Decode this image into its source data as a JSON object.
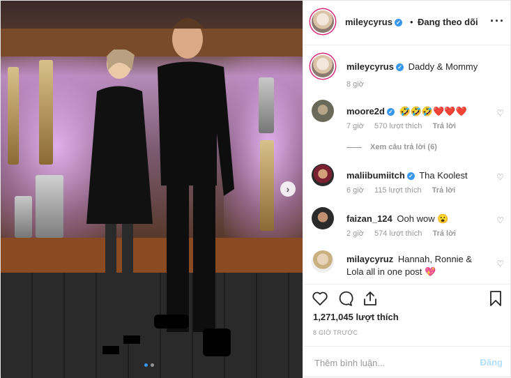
{
  "header": {
    "username": "mileycyrus",
    "separator": "•",
    "follow_label": "Đang theo dõi",
    "more_icon": "more-horizontal-icon"
  },
  "caption": {
    "username": "mileycyrus",
    "text": "Daddy & Mommy",
    "time": "8 giờ"
  },
  "comments": [
    {
      "username": "moore2d",
      "text": "🤣🤣🤣❤️❤️❤️",
      "time": "7 giờ",
      "likes": "570 lượt thích",
      "reply": "Trả lời"
    },
    {
      "username": "maliibumiitch",
      "text": "Tha Koolest",
      "time": "6 giờ",
      "likes": "115 lượt thích",
      "reply": "Trả lời"
    },
    {
      "username": "faizan_124",
      "text": "Ooh wow 😮",
      "time": "2 giờ",
      "likes": "574 lượt thích",
      "reply": "Trả lời"
    },
    {
      "username": "milaycyruz",
      "text": "Hannah, Ronnie & Lola all in one post 💖"
    }
  ],
  "view_replies": "Xem câu trả lời (6)",
  "likes_count": "1,271,045 lượt thích",
  "post_time": "8 GIỜ TRƯỚC",
  "add_comment": {
    "placeholder": "Thêm bình luận...",
    "post_label": "Đăng"
  },
  "colors": {
    "accent": "#3897f0",
    "heart": "#ed4956"
  }
}
